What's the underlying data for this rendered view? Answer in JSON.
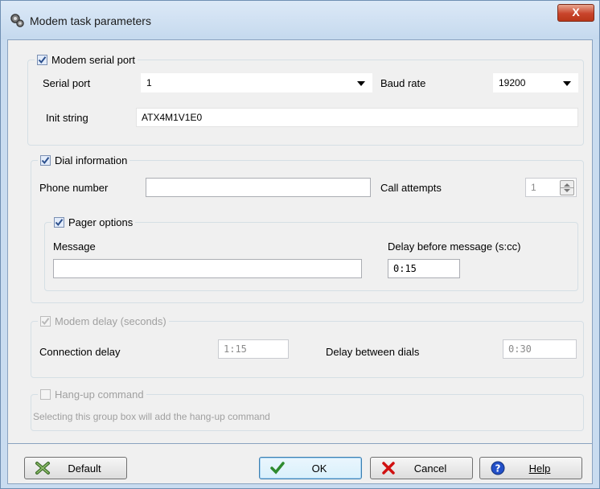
{
  "window": {
    "title": "Modem task parameters",
    "close_label": "X"
  },
  "modem_serial_port": {
    "label": "Modem serial port",
    "checked": true,
    "serial_port_label": "Serial port",
    "serial_port_value": "1",
    "baud_rate_label": "Baud rate",
    "baud_rate_value": "19200",
    "init_string_label": "Init string",
    "init_string_value": "ATX4M1V1E0"
  },
  "dial_information": {
    "label": "Dial information",
    "checked": true,
    "phone_number_label": "Phone number",
    "phone_number_value": "",
    "call_attempts_label": "Call attempts",
    "call_attempts_value": "1"
  },
  "pager_options": {
    "label": "Pager options",
    "checked": true,
    "message_label": "Message",
    "message_value": "",
    "delay_label": "Delay before message (s:cc)",
    "delay_value": "0:15"
  },
  "modem_delay": {
    "label": "Modem delay (seconds)",
    "checked": true,
    "enabled": false,
    "connection_delay_label": "Connection delay",
    "connection_delay_value": "1:15",
    "between_dials_label": "Delay between dials",
    "between_dials_value": "0:30"
  },
  "hang_up": {
    "label": "Hang-up command",
    "checked": false,
    "enabled": false,
    "description": "Selecting this group box will add the hang-up command"
  },
  "buttons": {
    "default_label": "Default",
    "ok_label": "OK",
    "cancel_label": "Cancel",
    "help_label": "Help"
  },
  "colors": {
    "accent": "#3c7fb1",
    "ok_check": "#2e8b2e",
    "cancel_x": "#d01010",
    "help_blue": "#2350c8"
  }
}
